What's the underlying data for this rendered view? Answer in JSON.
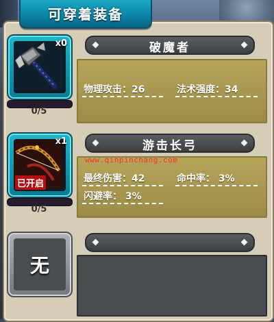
{
  "header": {
    "title": "可穿着装备"
  },
  "slots": [
    {
      "item_name": "破魔者",
      "count_label": "x0",
      "progress_label": "0/5",
      "progress_fraction": 0.0,
      "icon": "war-hammer-icon",
      "stats": [
        {
          "label": "物理攻击：26"
        },
        {
          "label": "法术强度：34"
        }
      ]
    },
    {
      "item_name": "游击长弓",
      "count_label": "x1",
      "progress_label": "0/5",
      "progress_fraction": 0.0,
      "icon": "longbow-icon",
      "badge": "已开启",
      "stats": [
        {
          "label": "最终伤害：42"
        },
        {
          "label": "命中率：  3%"
        },
        {
          "label": "闪避率：  3%"
        }
      ]
    },
    {
      "item_name": "",
      "empty_label": "无",
      "icon": "empty-slot-icon"
    }
  ],
  "watermark": "www.qinpinchang.com",
  "colors": {
    "slot_filled": "#1fb7c7",
    "slot_empty": "#aeb2b5",
    "stats_bg": "#b6a45a",
    "badge": "#b10f12",
    "watermark": "#ff2d2d"
  }
}
